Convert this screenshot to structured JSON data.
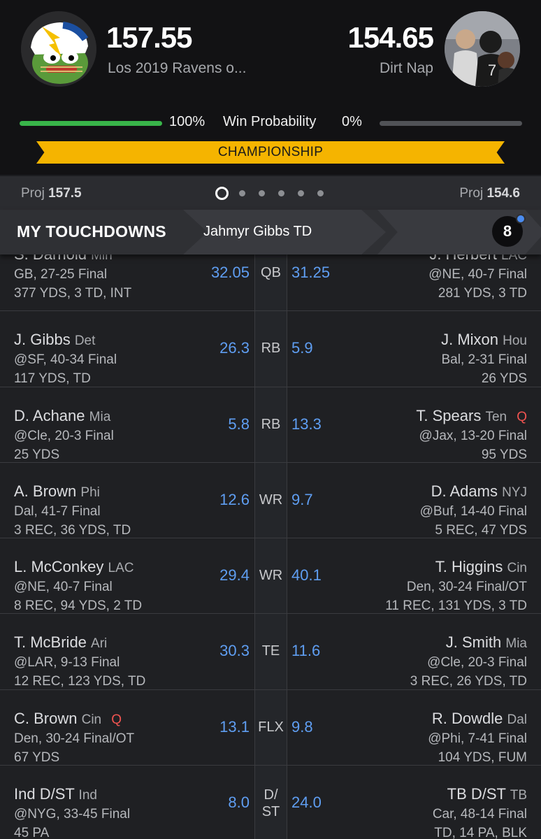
{
  "header": {
    "left": {
      "score": "157.55",
      "team": "Los 2019 Ravens o...",
      "win_pct": "100%",
      "proj_label": "Proj",
      "proj_value": "157.5"
    },
    "right": {
      "score": "154.65",
      "team": "Dirt Nap",
      "win_pct": "0%",
      "proj_label": "Proj",
      "proj_value": "154.6"
    },
    "win_label": "Win Probability",
    "banner": "CHAMPIONSHIP"
  },
  "colors": {
    "win_bar": "#39b54a",
    "lose_bar": "#515357",
    "banner": "#f5b400",
    "points": "#5f9ef2",
    "injury": "#ef5350"
  },
  "touchdowns": {
    "title": "MY TOUCHDOWNS",
    "latest": "Jahmyr Gibbs TD",
    "count": "8"
  },
  "rows": [
    {
      "pos": "QB",
      "left": {
        "name": "S. Darnold",
        "team": "Min",
        "game": "GB, 27-25 Final",
        "stats": "377 YDS, 3 TD, INT",
        "pts": "32.05"
      },
      "right": {
        "name": "J. Herbert",
        "team": "LAC",
        "game": "@NE, 40-7 Final",
        "stats": "281 YDS, 3 TD",
        "pts": "31.25"
      }
    },
    {
      "pos": "RB",
      "left": {
        "name": "J. Gibbs",
        "team": "Det",
        "game": "@SF, 40-34 Final",
        "stats": "117 YDS, TD",
        "pts": "26.3"
      },
      "right": {
        "name": "J. Mixon",
        "team": "Hou",
        "game": "Bal, 2-31 Final",
        "stats": "26 YDS",
        "pts": "5.9"
      }
    },
    {
      "pos": "RB",
      "left": {
        "name": "D. Achane",
        "team": "Mia",
        "game": "@Cle, 20-3 Final",
        "stats": "25 YDS",
        "pts": "5.8"
      },
      "right": {
        "name": "T. Spears",
        "team": "Ten",
        "injury": "Q",
        "game": "@Jax, 13-20 Final",
        "stats": "95 YDS",
        "pts": "13.3"
      }
    },
    {
      "pos": "WR",
      "left": {
        "name": "A. Brown",
        "team": "Phi",
        "game": "Dal, 41-7 Final",
        "stats": "3 REC, 36 YDS, TD",
        "pts": "12.6"
      },
      "right": {
        "name": "D. Adams",
        "team": "NYJ",
        "game": "@Buf, 14-40 Final",
        "stats": "5 REC, 47 YDS",
        "pts": "9.7"
      }
    },
    {
      "pos": "WR",
      "left": {
        "name": "L. McConkey",
        "team": "LAC",
        "game": "@NE, 40-7 Final",
        "stats": "8 REC, 94 YDS, 2 TD",
        "pts": "29.4"
      },
      "right": {
        "name": "T. Higgins",
        "team": "Cin",
        "game": "Den, 30-24 Final/OT",
        "stats": "11 REC, 131 YDS, 3 TD",
        "pts": "40.1"
      }
    },
    {
      "pos": "TE",
      "left": {
        "name": "T. McBride",
        "team": "Ari",
        "game": "@LAR, 9-13 Final",
        "stats": "12 REC, 123 YDS, TD",
        "pts": "30.3"
      },
      "right": {
        "name": "J. Smith",
        "team": "Mia",
        "game": "@Cle, 20-3 Final",
        "stats": "3 REC, 26 YDS, TD",
        "pts": "11.6"
      }
    },
    {
      "pos": "FLX",
      "left": {
        "name": "C. Brown",
        "team": "Cin",
        "injury": "Q",
        "game": "Den, 30-24 Final/OT",
        "stats": "67 YDS",
        "pts": "13.1"
      },
      "right": {
        "name": "R. Dowdle",
        "team": "Dal",
        "game": "@Phi, 7-41 Final",
        "stats": "104 YDS, FUM",
        "pts": "9.8"
      }
    },
    {
      "pos": "D/ ST",
      "left": {
        "name": "Ind D/ST",
        "team": "Ind",
        "game": "@NYG, 33-45 Final",
        "stats": "45 PA",
        "pts": "8.0"
      },
      "right": {
        "name": "TB D/ST",
        "team": "TB",
        "game": "Car, 48-14 Final",
        "stats": "TD, 14 PA, BLK",
        "pts": "24.0"
      }
    }
  ]
}
